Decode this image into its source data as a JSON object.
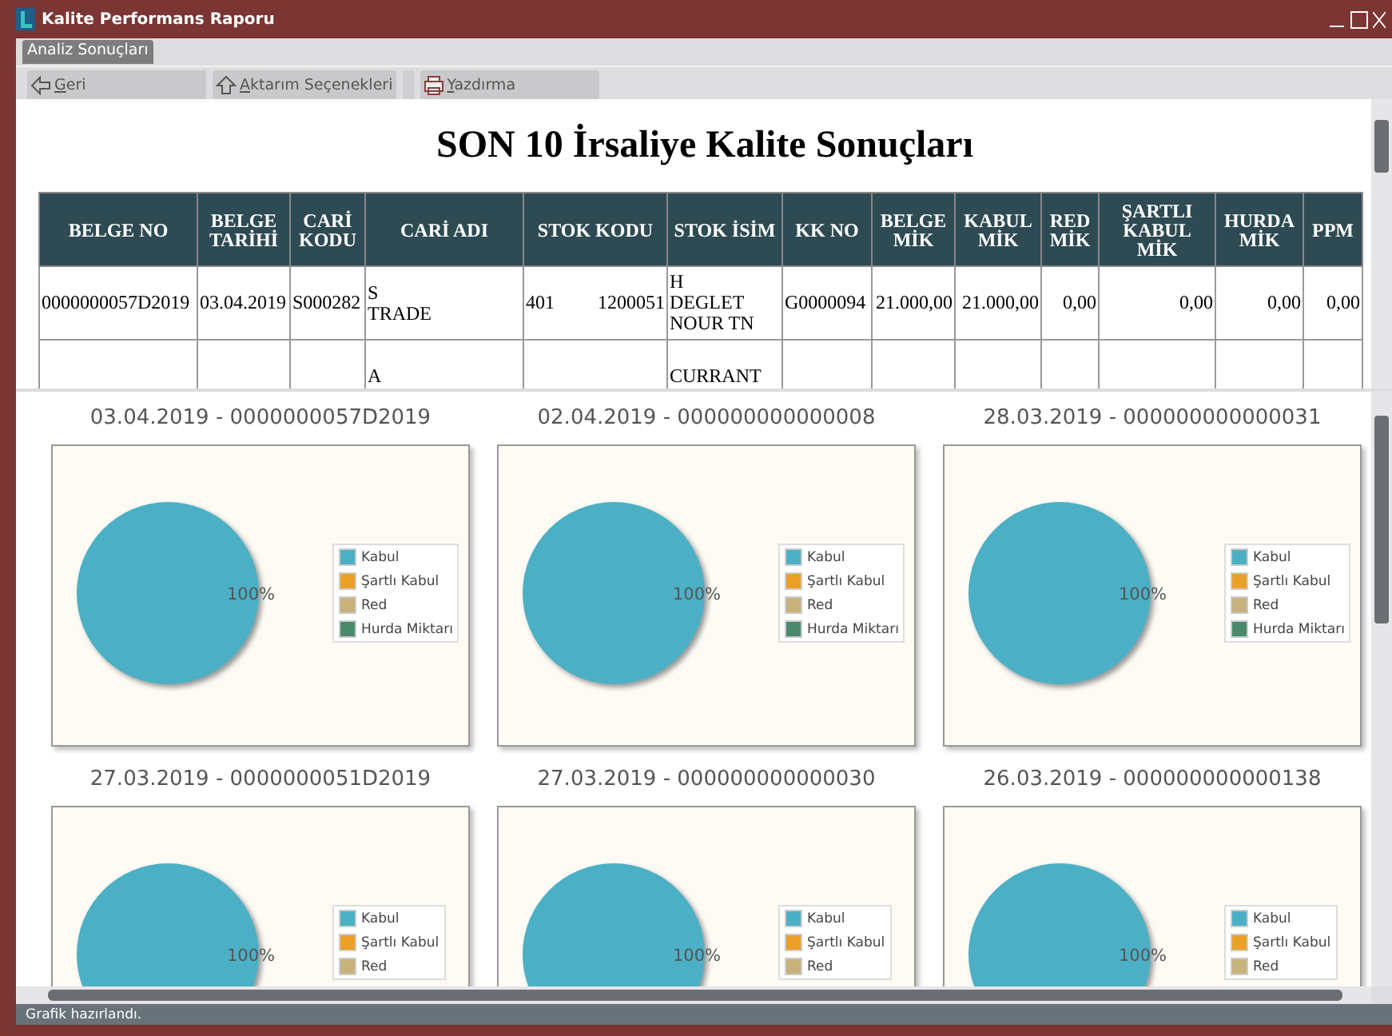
{
  "window": {
    "title": "Kalite Performans Raporu"
  },
  "tabs": [
    {
      "label": "Analiz Sonuçları",
      "selected": true
    }
  ],
  "toolbar": [
    {
      "label": "Geri",
      "kind": "back"
    },
    {
      "label": "Aktarım Seçenekleri",
      "kind": "export"
    },
    {
      "label": "Yazdırma",
      "kind": "print"
    }
  ],
  "report": {
    "title": "SON 10 İrsaliye Kalite Sonuçları",
    "columns": [
      {
        "label": "BELGE NO",
        "kind": "text"
      },
      {
        "label": "BELGE TARİHİ",
        "kind": "text"
      },
      {
        "label": "CARİ KODU",
        "kind": "text"
      },
      {
        "label": "CARİ ADI",
        "kind": "text"
      },
      {
        "label": "STOK KODU",
        "kind": "text"
      },
      {
        "label": "STOK İSİM",
        "kind": "text"
      },
      {
        "label": "KK NO",
        "kind": "text"
      },
      {
        "label": "BELGE MİK",
        "kind": "number"
      },
      {
        "label": "KABUL MİK",
        "kind": "number"
      },
      {
        "label": "RED MİK",
        "kind": "number"
      },
      {
        "label": "ŞARTLI KABUL MİK",
        "kind": "number"
      },
      {
        "label": "HURDA MİK",
        "kind": "number"
      },
      {
        "label": "PPM",
        "kind": "number"
      }
    ],
    "rows": [
      [
        "0000000057D2019",
        "03.04.2019",
        "S000282",
        "S\nTRADE",
        "401         1200051",
        "H\nDEGLET\nNOUR TN",
        "G0000094",
        "21.000,00",
        "21.000,00",
        "0,00",
        "0,00",
        "0,00",
        "0,00"
      ],
      [
        null,
        null,
        null,
        "A",
        null,
        "CURRANT",
        null,
        null,
        null,
        null,
        null,
        null,
        null
      ]
    ]
  },
  "charts": [
    {
      "title": "03.04.2019 - 0000000057D2019",
      "slice_label": "100%",
      "legend": [
        {
          "label": "Kabul",
          "color": "#4bb0c5"
        },
        {
          "label": "Şartlı Kabul",
          "color": "#eba026"
        },
        {
          "label": "Red",
          "color": "#c6b27a"
        },
        {
          "label": "Hurda Miktarı",
          "color": "#4a8a6c"
        }
      ]
    },
    {
      "title": "02.04.2019 - 000000000000008",
      "slice_label": "100%",
      "legend": [
        {
          "label": "Kabul",
          "color": "#4bb0c5"
        },
        {
          "label": "Şartlı Kabul",
          "color": "#eba026"
        },
        {
          "label": "Red",
          "color": "#c6b27a"
        },
        {
          "label": "Hurda Miktarı",
          "color": "#4a8a6c"
        }
      ]
    },
    {
      "title": "28.03.2019 - 000000000000031",
      "slice_label": "100%",
      "legend": [
        {
          "label": "Kabul",
          "color": "#4bb0c5"
        },
        {
          "label": "Şartlı Kabul",
          "color": "#eba026"
        },
        {
          "label": "Red",
          "color": "#c6b27a"
        },
        {
          "label": "Hurda Miktarı",
          "color": "#4a8a6c"
        }
      ]
    },
    {
      "title": "27.03.2019 - 0000000051D2019",
      "slice_label": "100%",
      "legend": [
        {
          "label": "Kabul",
          "color": "#4bb0c5"
        },
        {
          "label": "Şartlı Kabul",
          "color": "#eba026"
        },
        {
          "label": "Red",
          "color": "#c6b27a"
        }
      ]
    },
    {
      "title": "27.03.2019 - 000000000000030",
      "slice_label": "100%",
      "legend": [
        {
          "label": "Kabul",
          "color": "#4bb0c5"
        },
        {
          "label": "Şartlı Kabul",
          "color": "#eba026"
        },
        {
          "label": "Red",
          "color": "#c6b27a"
        }
      ]
    },
    {
      "title": "26.03.2019 - 000000000000138",
      "slice_label": "100%",
      "legend": [
        {
          "label": "Kabul",
          "color": "#4bb0c5"
        },
        {
          "label": "Şartlı Kabul",
          "color": "#eba026"
        },
        {
          "label": "Red",
          "color": "#c6b27a"
        }
      ]
    }
  ],
  "status_bar": {
    "text": "Grafik hazırlandı."
  }
}
